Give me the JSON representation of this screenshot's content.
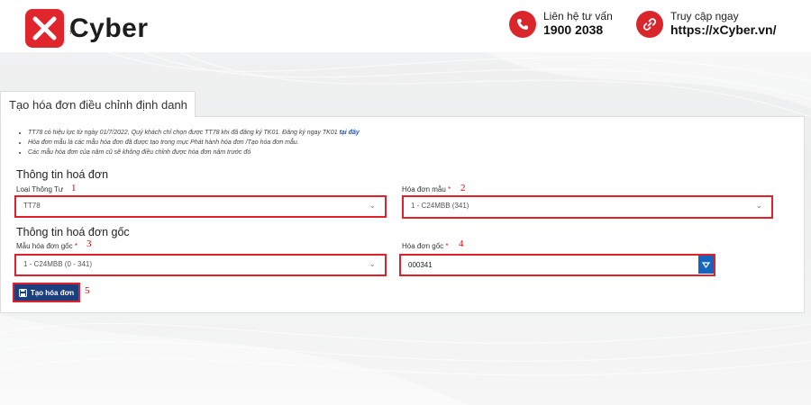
{
  "brand": {
    "name": "Cyber",
    "tm": "TM",
    "colors": {
      "primary": "#e0262c",
      "dark": "#1d1d1f",
      "button": "#1c3f7e",
      "highlight": "#e0202a"
    }
  },
  "contact": {
    "phone_label": "Liên hệ tư vấn",
    "phone_value": "1900 2038",
    "site_label": "Truy cập ngay",
    "site_value": "https://xCyber.vn/"
  },
  "page": {
    "tab_title": "Tạo hóa đơn điều chỉnh định danh",
    "notes": {
      "note1_text": "TT78 có hiệu lực từ ngày 01/7/2022, Quý khách chỉ chọn được TT78 khi đã đăng ký TK01. Đăng ký ngay TK01 ",
      "note1_link": "tại đây",
      "note2": "Hóa đơn mẫu là các mẫu hóa đơn đã được tạo trong mục Phát hành hóa đơn /Tạo hóa đơn mẫu.",
      "note3": "Các mẫu hóa đơn của năm cũ sẽ không điều chỉnh được hóa đơn năm trước đó"
    },
    "section1_title": "Thông tin hoá đơn",
    "section2_title": "Thông tin hoá đơn gốc",
    "fields": {
      "loai_thong_tu": {
        "label": "Loại Thông Tư",
        "value": "TT78",
        "marker": "1"
      },
      "hoa_don_mau": {
        "label": "Hóa đơn mẫu",
        "required": "*",
        "value": "1 - C24MBB (341)",
        "marker": "2"
      },
      "mau_hoa_don_goc": {
        "label": "Mẫu hóa đơn gốc",
        "required": "*",
        "value": "1 - C24MBB (0 - 341)",
        "marker": "3"
      },
      "hoa_don_goc": {
        "label": "Hóa đơn gốc",
        "required": "*",
        "value": "000341",
        "marker": "4"
      }
    },
    "create_button": {
      "label": "Tạo hóa đơn",
      "marker": "5"
    }
  },
  "icons": [
    "phone-icon",
    "link-icon",
    "chevron-down-icon",
    "caret-down-icon",
    "save-icon"
  ]
}
